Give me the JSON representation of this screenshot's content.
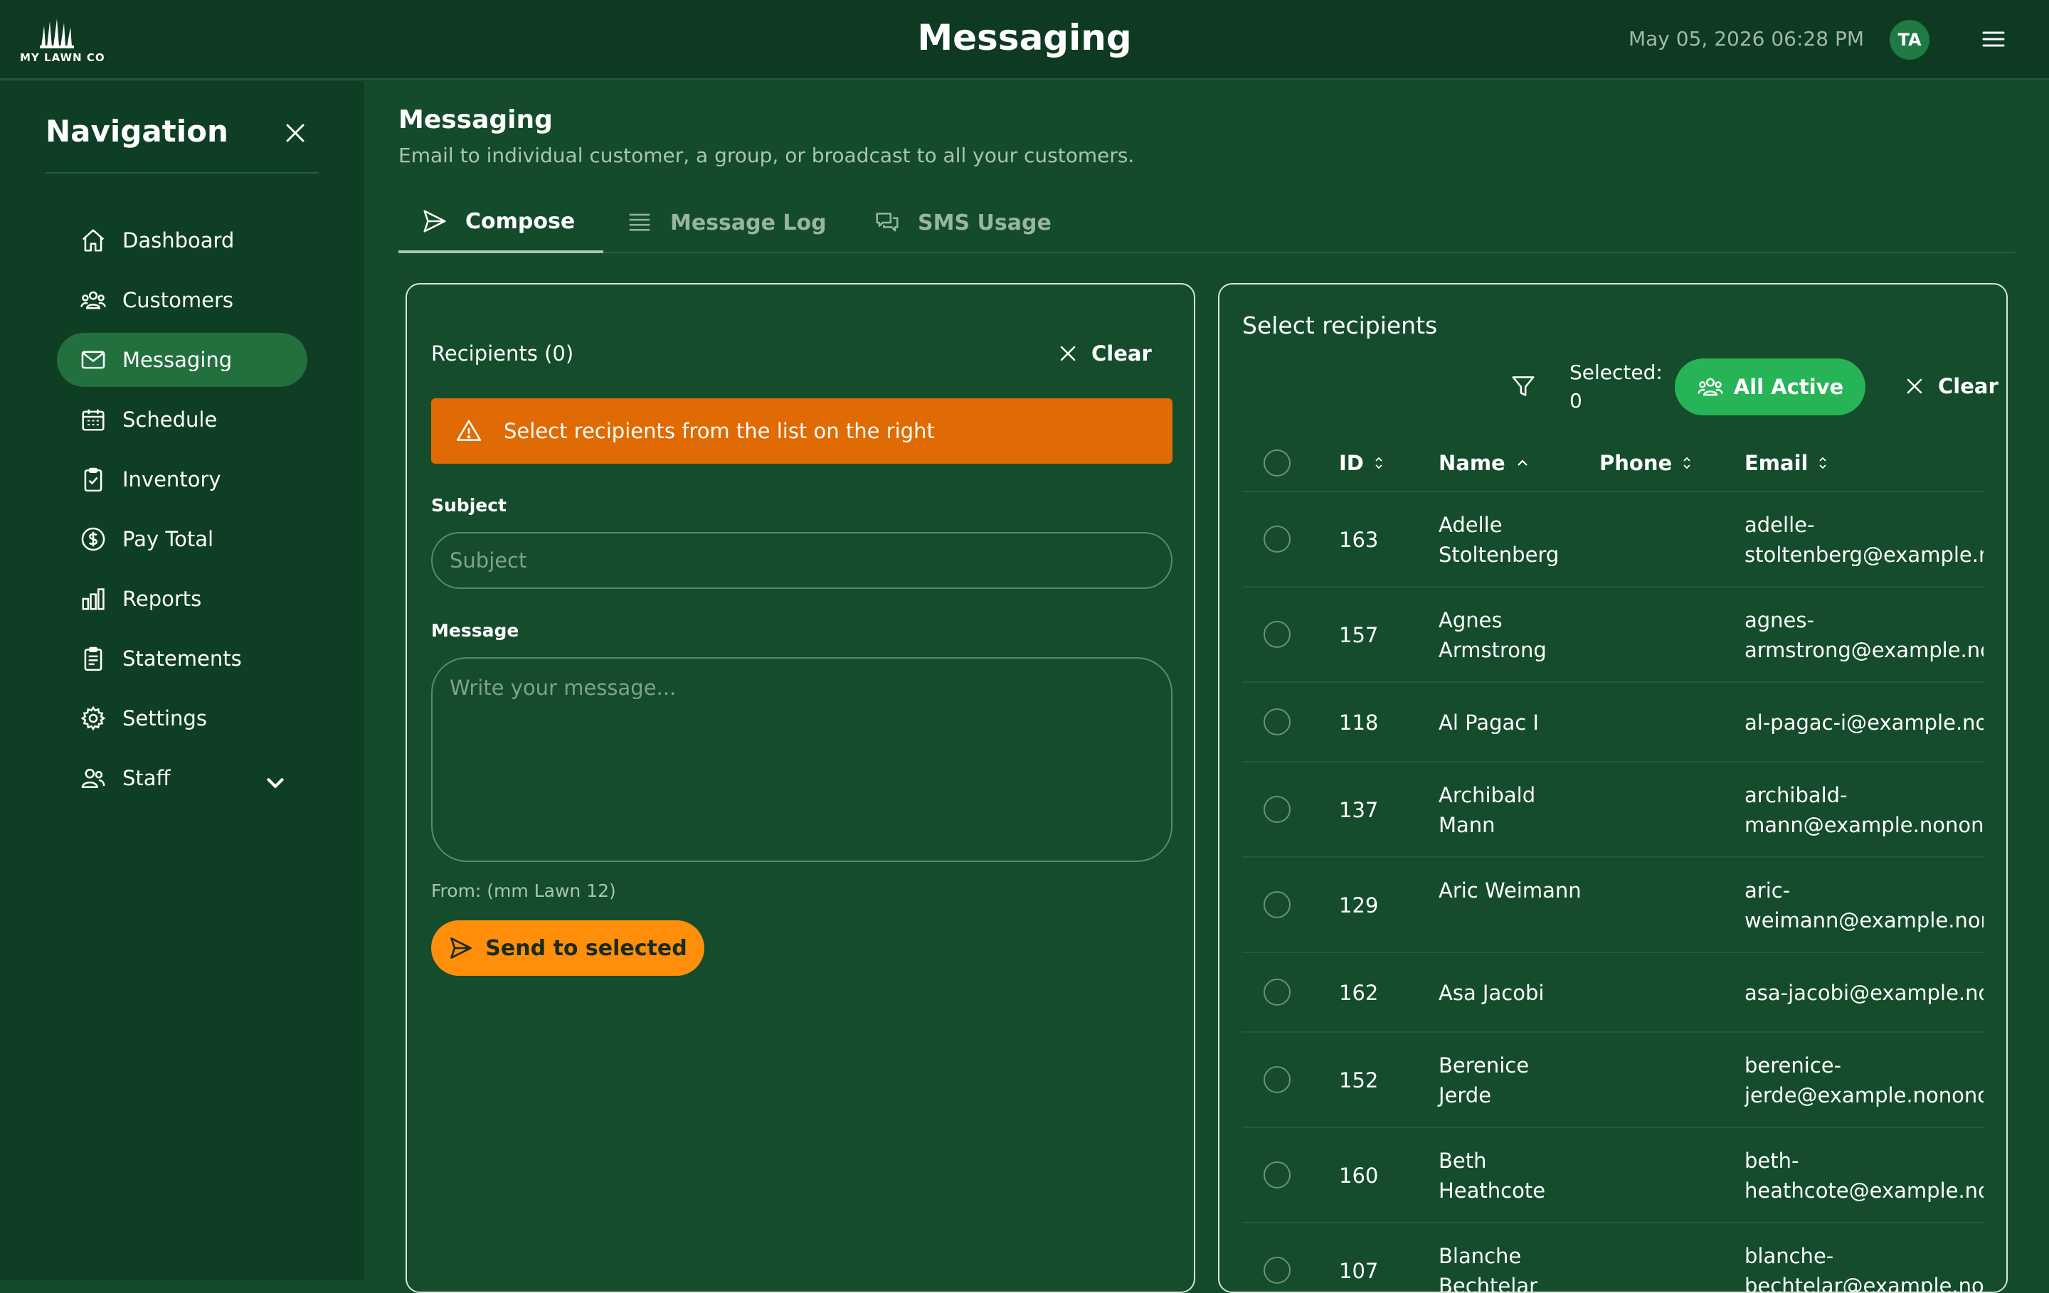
{
  "header": {
    "logo_text": "MY LAWN CO",
    "title": "Messaging",
    "datetime": "May 05, 2026 06:28 PM",
    "avatar_initials": "TA"
  },
  "sidebar": {
    "title": "Navigation",
    "items": [
      {
        "label": "Dashboard",
        "icon": "home-icon"
      },
      {
        "label": "Customers",
        "icon": "customers-icon"
      },
      {
        "label": "Messaging",
        "icon": "mail-icon",
        "active": true
      },
      {
        "label": "Schedule",
        "icon": "calendar-icon"
      },
      {
        "label": "Inventory",
        "icon": "clipboard-check-icon"
      },
      {
        "label": "Pay Total",
        "icon": "dollar-icon"
      },
      {
        "label": "Reports",
        "icon": "bar-chart-icon"
      },
      {
        "label": "Statements",
        "icon": "document-icon"
      },
      {
        "label": "Settings",
        "icon": "gear-icon"
      },
      {
        "label": "Staff",
        "icon": "staff-icon",
        "expandable": true
      }
    ]
  },
  "page": {
    "title": "Messaging",
    "subtitle": "Email to individual customer, a group, or broadcast to all your customers."
  },
  "tabs": [
    {
      "label": "Compose",
      "icon": "send-icon",
      "active": true
    },
    {
      "label": "Message Log",
      "icon": "list-icon"
    },
    {
      "label": "SMS Usage",
      "icon": "chat-icon"
    }
  ],
  "compose": {
    "recipients_label": "Recipients (0)",
    "clear_label": "Clear",
    "alert_text": "Select recipients from the list on the right",
    "subject_label": "Subject",
    "subject_placeholder": "Subject",
    "subject_value": "",
    "message_label": "Message",
    "message_placeholder": "Write your message...",
    "message_value": "",
    "from_text": "From: (mm Lawn 12)",
    "send_label": "Send to selected"
  },
  "recipients": {
    "title": "Select recipients",
    "selected_label": "Selected:",
    "selected_count": "0",
    "all_active_label": "All Active",
    "clear_label": "Clear",
    "columns": {
      "id": "ID",
      "name": "Name",
      "phone": "Phone",
      "email": "Email"
    },
    "rows": [
      {
        "id": "163",
        "name": "Adelle Stoltenberg",
        "phone": "",
        "email": "adelle-stoltenberg@example.nonono"
      },
      {
        "id": "157",
        "name": "Agnes Armstrong",
        "phone": "",
        "email": "agnes-armstrong@example.nonono"
      },
      {
        "id": "118",
        "name": "Al Pagac I",
        "phone": "",
        "email": "al-pagac-i@example.nonono"
      },
      {
        "id": "137",
        "name": "Archibald Mann",
        "phone": "",
        "email": "archibald-mann@example.nonono"
      },
      {
        "id": "129",
        "name": "Aric Weimann",
        "phone": "",
        "email": "aric-weimann@example.nonono"
      },
      {
        "id": "162",
        "name": "Asa Jacobi",
        "phone": "",
        "email": "asa-jacobi@example.nonono"
      },
      {
        "id": "152",
        "name": "Berenice Jerde",
        "phone": "",
        "email": "berenice-jerde@example.nonono"
      },
      {
        "id": "160",
        "name": "Beth Heathcote",
        "phone": "",
        "email": "beth-heathcote@example.nonono"
      },
      {
        "id": "107",
        "name": "Blanche Bechtelar",
        "phone": "",
        "email": "blanche-bechtelar@example.nonono"
      }
    ]
  },
  "colors": {
    "background": "#134b2b",
    "topbar": "#0d3a21",
    "sidebar": "#0e3e23",
    "active_nav": "#23703f",
    "alert": "#e06b04",
    "send_button": "#ff8f0a",
    "all_active_button": "#27b456"
  }
}
